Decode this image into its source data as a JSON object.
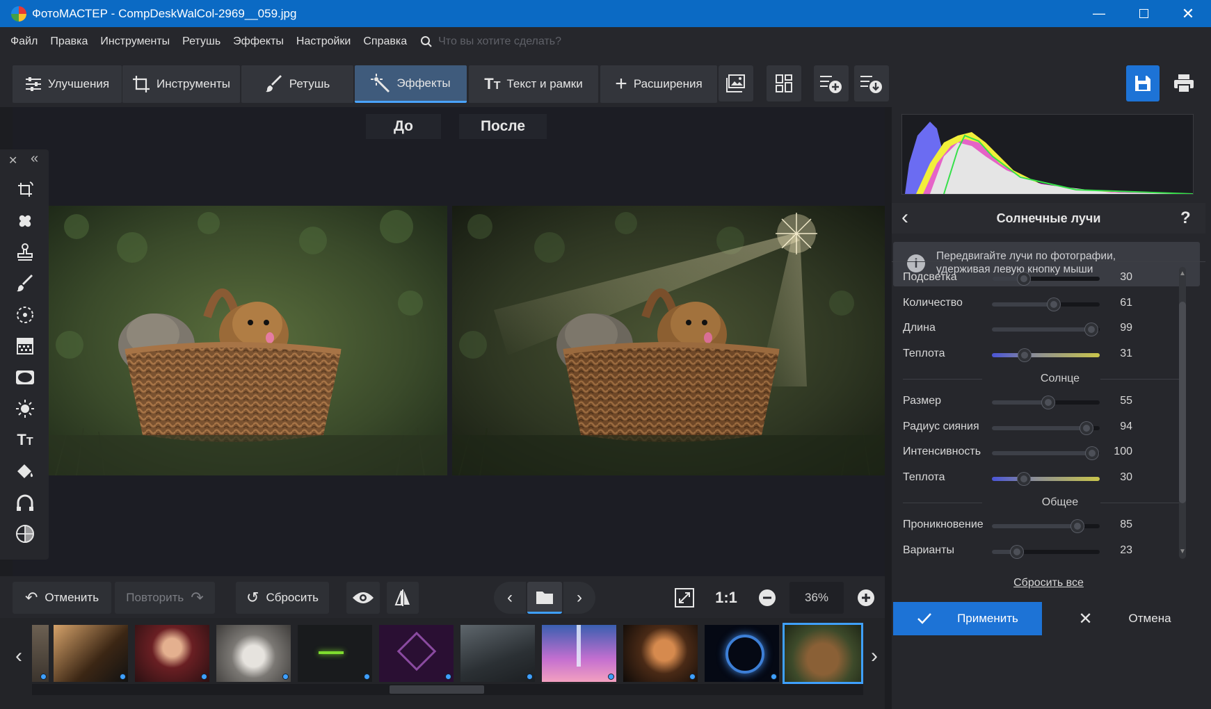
{
  "window": {
    "title": "ФотоМАСТЕР - CompDeskWalCol-2969__059.jpg"
  },
  "menu": [
    "Файл",
    "Правка",
    "Инструменты",
    "Ретушь",
    "Эффекты",
    "Настройки",
    "Справка"
  ],
  "search": {
    "placeholder": "Что вы хотите сделать?"
  },
  "tabs": [
    {
      "label": "Улучшения",
      "icon": "sliders-icon"
    },
    {
      "label": "Инструменты",
      "icon": "crop-icon"
    },
    {
      "label": "Ретушь",
      "icon": "brush-icon"
    },
    {
      "label": "Эффекты",
      "icon": "magic-wand-icon",
      "active": true
    },
    {
      "label": "Текст и рамки",
      "icon": "text-icon"
    },
    {
      "label": "Расширения",
      "icon": "plus-icon"
    }
  ],
  "compare": {
    "before": "До",
    "after": "После"
  },
  "bottombar": {
    "undo": "Отменить",
    "redo": "Повторить",
    "reset": "Сбросить",
    "zoom_1to1": "1:1",
    "zoom": "36%"
  },
  "panel": {
    "title": "Солнечные лучи",
    "help": "?",
    "info": "Передвигайте лучи по фотографии, удерживая левую кнопку мыши",
    "sliders_rays": [
      {
        "label": "Подсветка",
        "value": 30
      },
      {
        "label": "Количество",
        "value": 61
      },
      {
        "label": "Длина",
        "value": 99
      },
      {
        "label": "Теплота",
        "value": 31,
        "warm": true
      }
    ],
    "section_sun": "Солнце",
    "sliders_sun": [
      {
        "label": "Размер",
        "value": 55
      },
      {
        "label": "Радиус сияния",
        "value": 94
      },
      {
        "label": "Интенсивность",
        "value": 100
      },
      {
        "label": "Теплота",
        "value": 30,
        "warm": true
      }
    ],
    "section_common": "Общее",
    "sliders_common": [
      {
        "label": "Проникновение",
        "value": 85
      },
      {
        "label": "Варианты",
        "value": 23
      }
    ],
    "reset_all": "Сбросить все",
    "apply": "Применить",
    "cancel": "Отмена"
  },
  "colors": {
    "accent": "#1d73d6",
    "titlebar": "#0b6ac4",
    "active_tab": "#3f5b7c"
  }
}
